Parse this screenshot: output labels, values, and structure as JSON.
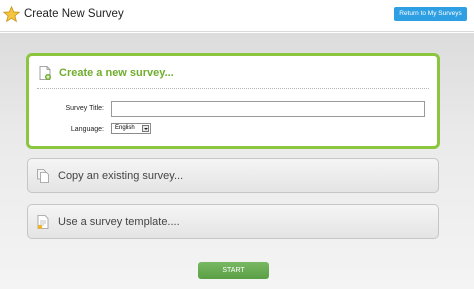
{
  "header": {
    "title": "Create New Survey",
    "return_label": "Return to My Surveys",
    "icon": "star-icon"
  },
  "options": {
    "create": {
      "title": "Create a new survey...",
      "survey_title_label": "Survey Title:",
      "survey_title_value": "",
      "language_label": "Language:",
      "language_value": "English",
      "icon": "new-document-icon"
    },
    "copy": {
      "title": "Copy an existing survey...",
      "icon": "copy-documents-icon"
    },
    "template": {
      "title": "Use a survey template....",
      "icon": "template-document-icon"
    }
  },
  "start_label": "START",
  "colors": {
    "accent_green": "#8cc63f",
    "title_green": "#6fae2e",
    "button_blue": "#2f9fe3",
    "start_green": "#5a9f46"
  }
}
